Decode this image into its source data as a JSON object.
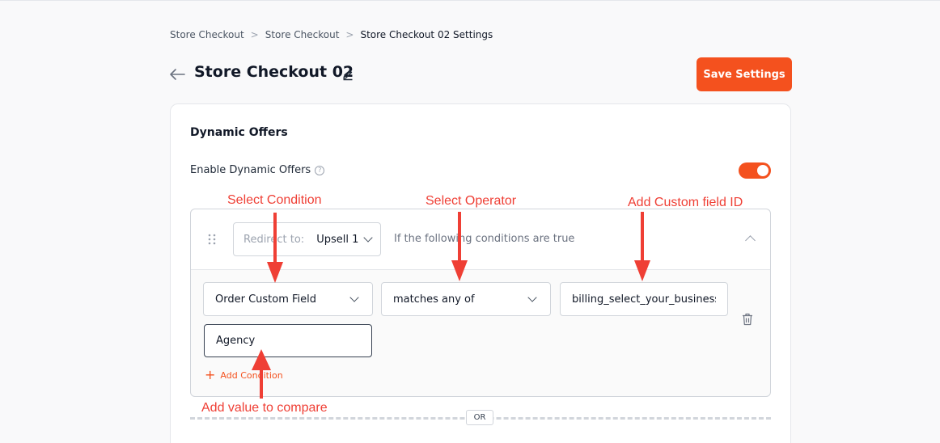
{
  "breadcrumb": {
    "items": [
      "Store Checkout",
      "Store Checkout",
      "Store Checkout 02 Settings"
    ],
    "separator": ">"
  },
  "header": {
    "title": "Store Checkout 02",
    "save_label": "Save Settings"
  },
  "section": {
    "title": "Dynamic Offers",
    "enable_label": "Enable Dynamic Offers",
    "enabled": true
  },
  "rule": {
    "redirect_label": "Redirect to:",
    "redirect_value": "Upsell 1",
    "conditions_text": "If the following conditions are true",
    "condition_select": "Order Custom Field",
    "operator_select": "matches any of",
    "field_id_value": "billing_select_your_business_",
    "compare_value": "Agency",
    "add_condition_label": "Add Condition"
  },
  "or_label": "OR",
  "annotations": {
    "select_condition": "Select Condition",
    "select_operator": "Select Operator",
    "add_field_id": "Add Custom field ID",
    "add_value": "Add value to compare"
  },
  "colors": {
    "accent": "#f4511e",
    "annotation": "#ef3f35"
  }
}
